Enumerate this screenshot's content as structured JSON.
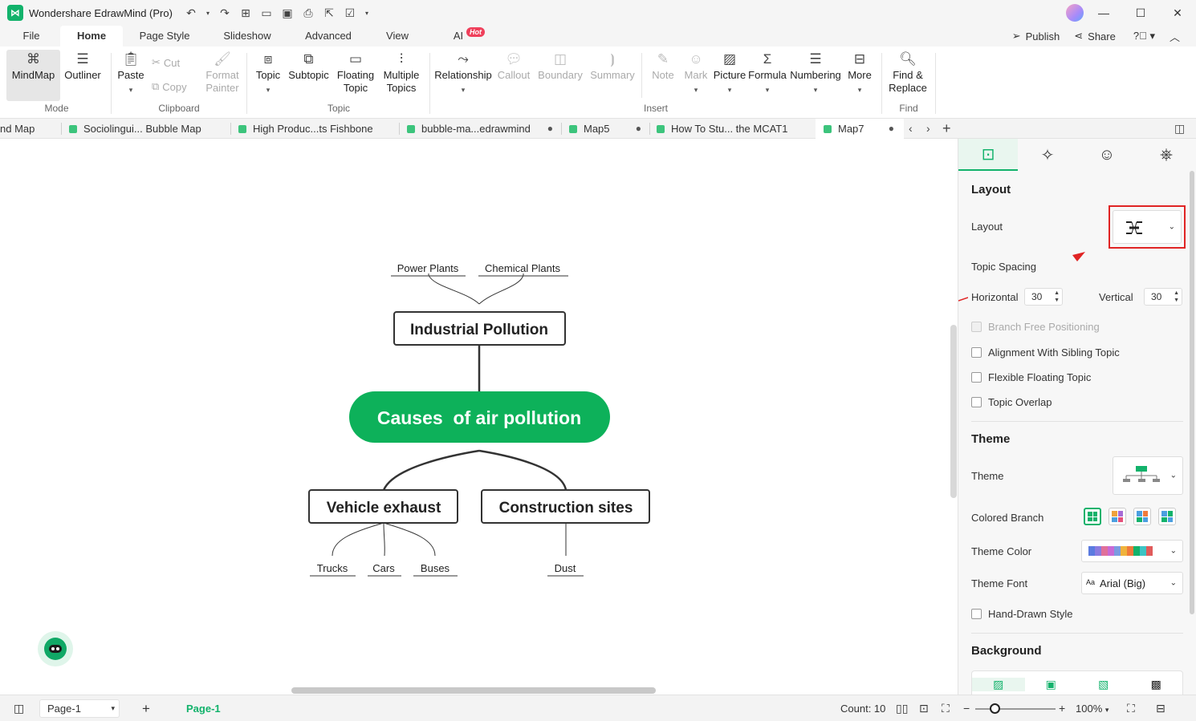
{
  "app": {
    "title": "Wondershare EdrawMind (Pro)"
  },
  "menu": {
    "tabs": [
      "File",
      "Home",
      "Page Style",
      "Slideshow",
      "Advanced",
      "View",
      "AI"
    ],
    "hot_badge": "Hot",
    "publish": "Publish",
    "share": "Share"
  },
  "ribbon": {
    "mindmap": "MindMap",
    "outliner": "Outliner",
    "mode_group": "Mode",
    "paste": "Paste",
    "cut": "Cut",
    "copy": "Copy",
    "format_painter_1": "Format",
    "format_painter_2": "Painter",
    "clipboard_group": "Clipboard",
    "topic": "Topic",
    "subtopic": "Subtopic",
    "floating_topic_1": "Floating",
    "floating_topic_2": "Topic",
    "multiple_topics_1": "Multiple",
    "multiple_topics_2": "Topics",
    "topic_group": "Topic",
    "relationship": "Relationship",
    "callout": "Callout",
    "boundary": "Boundary",
    "summary": "Summary",
    "note": "Note",
    "mark": "Mark",
    "picture": "Picture",
    "formula": "Formula",
    "numbering": "Numbering",
    "more": "More",
    "insert_group": "Insert",
    "find_replace_1": "Find &",
    "find_replace_2": "Replace",
    "find_group": "Find"
  },
  "doc_tabs": [
    "nd Map",
    "Sociolingui... Bubble Map",
    "High Produc...ts Fishbone",
    "bubble-ma...edrawmind",
    "Map5",
    "How To Stu... the MCAT1",
    "Map7"
  ],
  "mindmap": {
    "central": "Causes  of air pollution",
    "main_topics": [
      "Industrial Pollution",
      "Vehicle exhaust",
      "Construction sites"
    ],
    "industrial_subtopics": [
      "Power Plants",
      "Chemical Plants"
    ],
    "vehicle_subtopics": [
      "Trucks",
      "Cars",
      "Buses"
    ],
    "construction_subtopics": [
      "Dust"
    ],
    "central_color": "#0db15a",
    "line_color": "#333333"
  },
  "panel": {
    "layout_section": "Layout",
    "layout_label": "Layout",
    "topic_spacing": "Topic Spacing",
    "horizontal_label": "Horizontal",
    "horizontal_value": "30",
    "vertical_label": "Vertical",
    "vertical_value": "30",
    "branch_free": "Branch Free Positioning",
    "alignment_sibling": "Alignment With Sibling Topic",
    "flexible_floating": "Flexible Floating Topic",
    "topic_overlap": "Topic Overlap",
    "theme_section": "Theme",
    "theme_label": "Theme",
    "colored_branch": "Colored Branch",
    "theme_color": "Theme Color",
    "theme_font": "Theme Font",
    "theme_font_value": "Arial (Big)",
    "theme_font_prefix": "Aa",
    "hand_drawn": "Hand-Drawn Style",
    "background_section": "Background",
    "accent_color": "#12b26b",
    "highlight_color": "#e02424"
  },
  "status": {
    "page_select": "Page-1",
    "page_tab": "Page-1",
    "count": "Count: 10",
    "zoom": "100%"
  }
}
